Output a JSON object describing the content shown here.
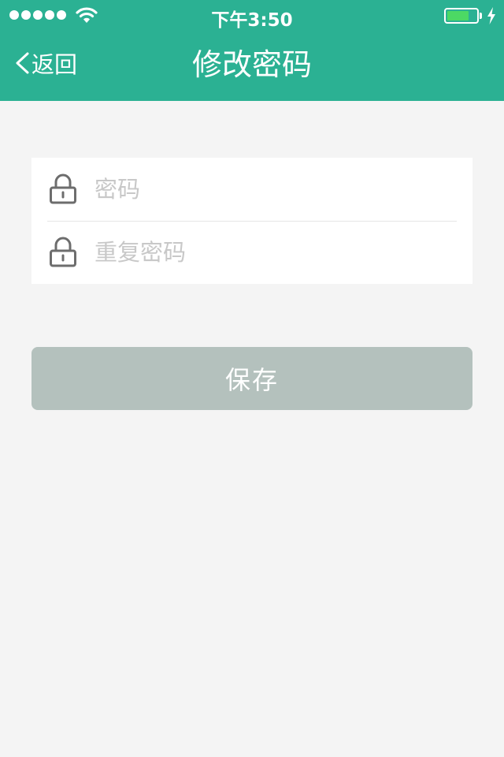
{
  "status_bar": {
    "time": "下午3:50",
    "signal_icon": "signal-dots-icon",
    "wifi_icon": "wifi-icon",
    "battery_icon": "battery-icon",
    "battery_level": 0.75,
    "battery_color": "#4cd964",
    "charging_icon": "lightning-bolt-icon"
  },
  "nav": {
    "back_icon": "chevron-left-icon",
    "back_label": "返回",
    "title": "修改密码",
    "background_color": "#2bb193"
  },
  "form": {
    "password": {
      "icon": "lock-icon",
      "value": "",
      "placeholder": "密码"
    },
    "repeat_password": {
      "icon": "lock-icon",
      "value": "",
      "placeholder": "重复密码"
    }
  },
  "actions": {
    "save_label": "保存",
    "save_color": "#b4c1bd"
  }
}
